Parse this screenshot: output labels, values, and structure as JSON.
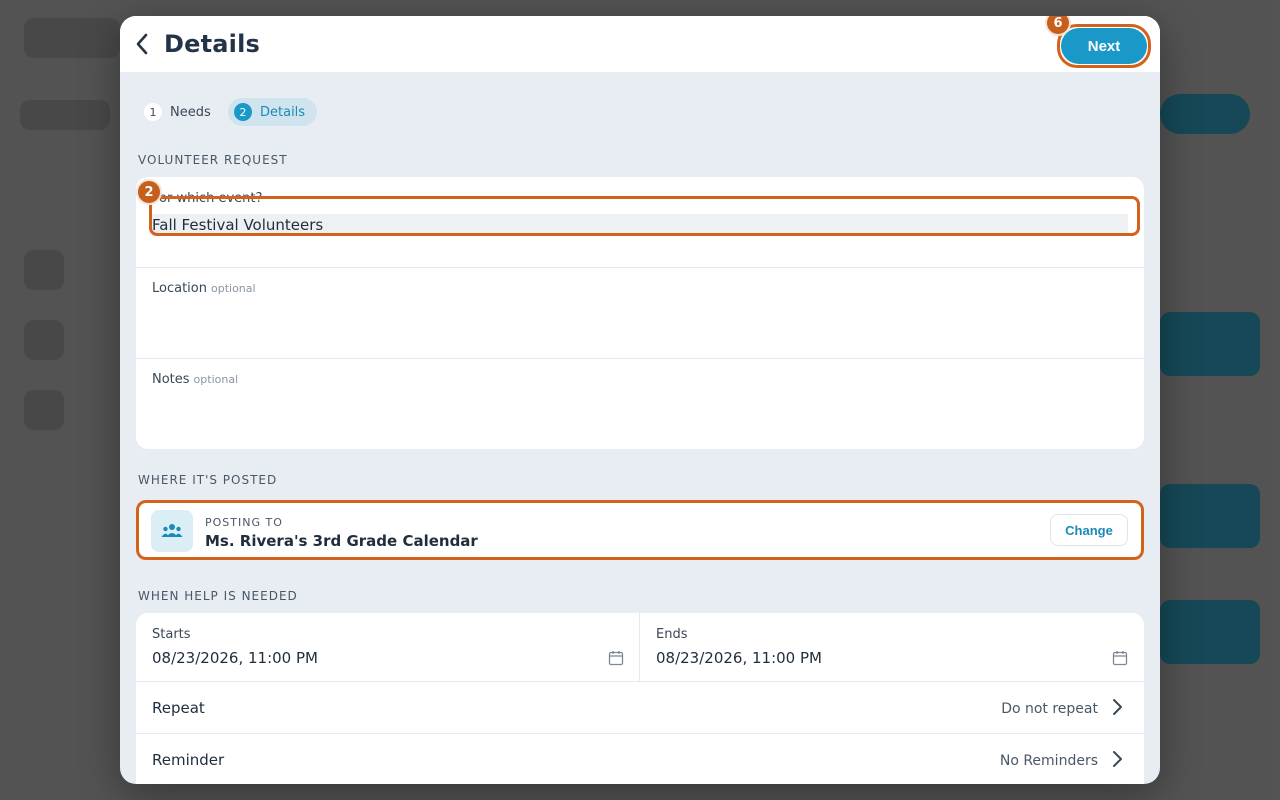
{
  "header": {
    "title": "Details",
    "next_label": "Next",
    "next_badge": "6"
  },
  "stepper": [
    {
      "num": "1",
      "label": "Needs"
    },
    {
      "num": "2",
      "label": "Details"
    }
  ],
  "volunteer_request": {
    "section_label": "VOLUNTEER REQUEST",
    "event_label": "For which event?",
    "event_value": "Fall Festival Volunteers",
    "event_badge": "2",
    "location_label": "Location",
    "notes_label": "Notes",
    "optional_text": "optional"
  },
  "posted": {
    "section_label": "WHERE IT'S POSTED",
    "posting_to_label": "POSTING TO",
    "calendar_name": "Ms. Rivera's 3rd Grade Calendar",
    "change_label": "Change"
  },
  "when": {
    "section_label": "WHEN HELP IS NEEDED",
    "starts_label": "Starts",
    "starts_value": "08/23/2026, 11:00 PM",
    "ends_label": "Ends",
    "ends_value": "08/23/2026, 11:00 PM",
    "repeat_label": "Repeat",
    "repeat_value": "Do not repeat",
    "reminder_label": "Reminder",
    "reminder_value": "No Reminders"
  },
  "colors": {
    "accent": "#1a98c7",
    "highlight": "#d3621b",
    "modal_bg": "#e8edf3"
  },
  "icons": {
    "back": "chevron-left-icon",
    "group": "group-icon",
    "calendar": "calendar-icon",
    "chevron": "chevron-right-icon"
  }
}
